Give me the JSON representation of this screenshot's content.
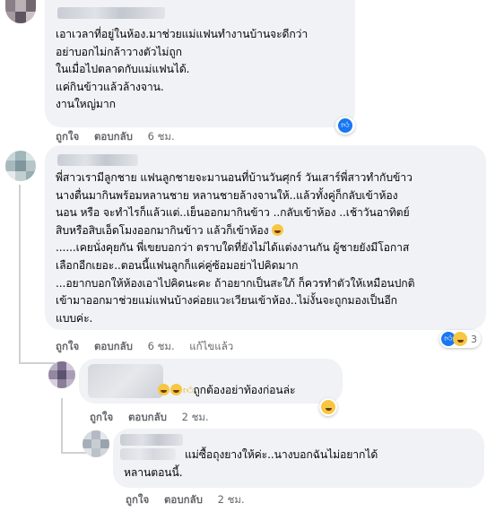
{
  "comments": [
    {
      "lines": [
        "เอาเวลาที่อยู่ในห้อง.มาช่วยแม่แฟนทำงานบ้านจะดีกว่า",
        "อย่าบอกไม่กล้าวางตัวไม่ถูก",
        "ในเมื่อไปตลาดกับแม่แฟนได้.",
        "แค่กินข้าวแล้วล้างจาน.",
        "งานใหญ่มาก"
      ],
      "like": "ถูกใจ",
      "reply": "ตอบกลับ",
      "time": "6 ชม.",
      "reaction": {
        "icons": [
          "like-icon"
        ],
        "count": ""
      }
    },
    {
      "lines": [
        "พี่สาวเรามีลูกชาย แฟนลูกชายจะมานอนที่บ้านวันศุกร์ วันเสาร์พี่สาวทำกับข้าว",
        "นางตื่นมากินพร้อมหลานชาย หลานชายล้างจานให้..แล้วทั้งคู่ก็กลับเข้าห้อง",
        "นอน หรือ จะทำไรก็แล้วแต่..เย็นออกมากินข้าว ..กลับเข้าห้อง ..เช้าวันอาทิตย์",
        "สิบหรือสิบเอ็ดโมงออกมากินข้าว แล้วก็เข้าห้อง",
        "......เคยนั่งคุยกัน พี่เขยบอกว่า ตราบใดที่ยังไม่ได้แต่งงานกัน ผู้ชายยังมีโอกาส",
        "เลือกอีกเยอะ..ตอนนี้แฟนลูกก็แค่คู่ซ้อมอย่าไปคิดมาก",
        "...อยากบอกให้ห้องเอาไปคิดนะคะ ถ้าอยากเป็นสะใภ้ ก็ควรทำตัวให้เหมือนปกติ",
        "เข้ามาออกมาช่วยแม่แฟนบ้างค่อยแวะเวียนเข้าห้อง..ไม่งั้นจะถูกมองเป็นอีก",
        "แบบค่ะ."
      ],
      "like": "ถูกใจ",
      "reply": "ตอบกลับ",
      "time": "6 ชม.",
      "edited": "แก้ไขแล้ว",
      "reaction": {
        "icons": [
          "like-icon",
          "haha-icon"
        ],
        "count": "3"
      }
    },
    {
      "lines": [
        "ถูกต้องอย่าท้องก่อนล่ะ"
      ],
      "like": "ถูกใจ",
      "reply": "ตอบกลับ",
      "time": "2 ชม.",
      "reaction": {
        "icons": [
          "haha-icon"
        ],
        "count": ""
      }
    },
    {
      "lines": [
        "แม่ซื้อถุงยางให้ค่ะ..นางบอกฉันไม่อยากได้",
        "หลานตอนนี้."
      ],
      "like": "ถูกใจ",
      "reply": "ตอบกลับ",
      "time": "2 ชม."
    }
  ],
  "colors": {
    "bubble": "#f0f2f5",
    "meta": "#65676b",
    "like_blue": "#1877f2",
    "haha": "#f7c744"
  }
}
